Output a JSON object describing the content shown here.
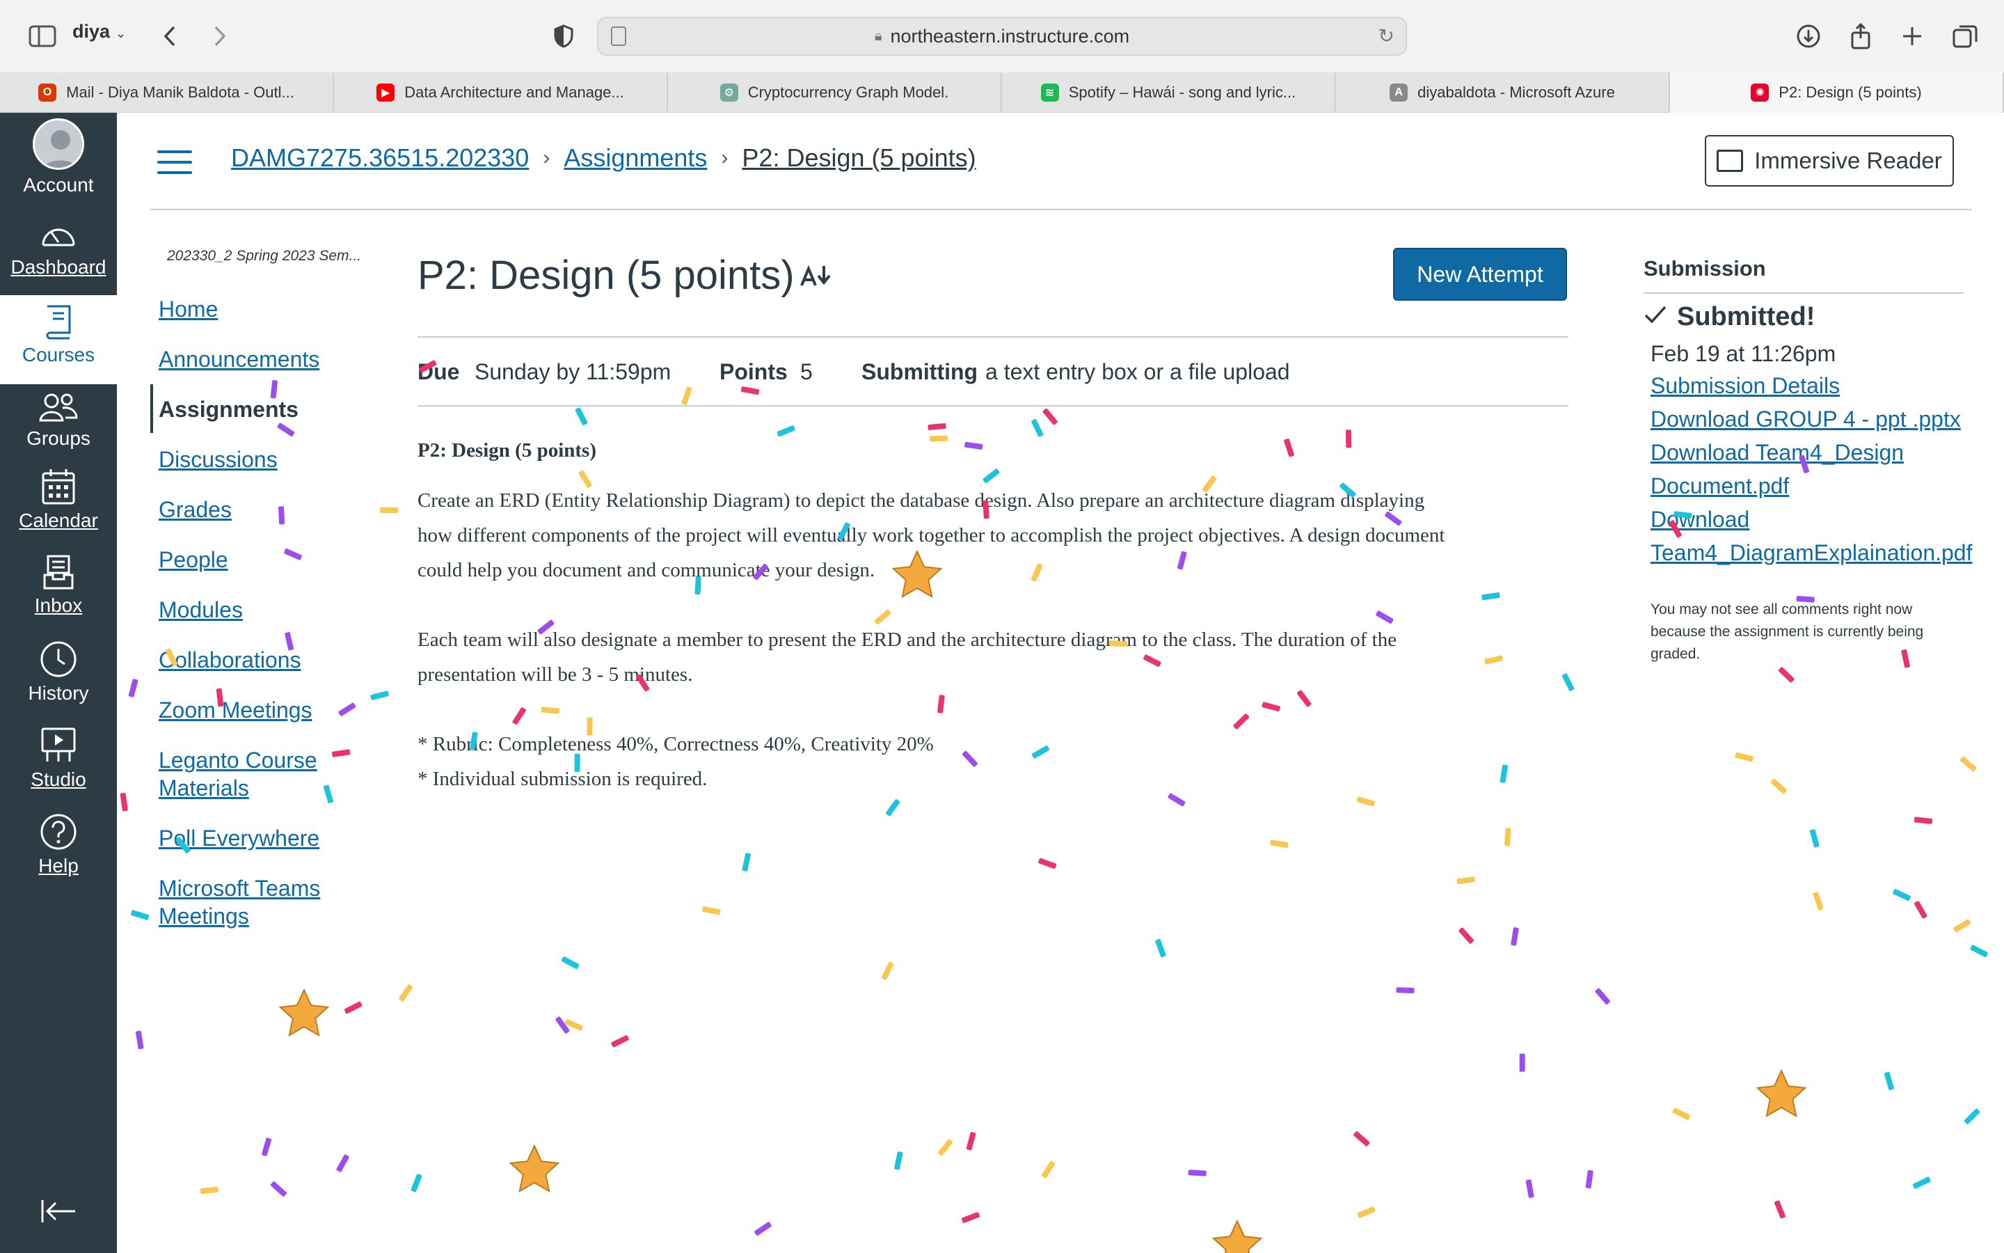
{
  "browser": {
    "profile": "diya",
    "url": "northeastern.instructure.com",
    "tabs": [
      {
        "label": "Mail - Diya Manik Baldota - Outl...",
        "color": "#d83b01",
        "glyph": "O"
      },
      {
        "label": "Data Architecture and Manage...",
        "color": "#ff0000",
        "glyph": "▶"
      },
      {
        "label": "Cryptocurrency Graph Model.",
        "color": "#74aa9c",
        "glyph": "⚙"
      },
      {
        "label": "Spotify – Hawái - song and lyric...",
        "color": "#1db954",
        "glyph": "≋"
      },
      {
        "label": "diyabaldota - Microsoft Azure",
        "color": "#8a8a8a",
        "glyph": "A"
      },
      {
        "label": "P2: Design (5 points)",
        "color": "#e4002b",
        "glyph": "✺"
      }
    ]
  },
  "global_nav": {
    "account": "Account",
    "dashboard": "Dashboard",
    "courses": "Courses",
    "groups": "Groups",
    "calendar": "Calendar",
    "inbox": "Inbox",
    "history": "History",
    "studio": "Studio",
    "help": "Help"
  },
  "header": {
    "breadcrumb": [
      "DAMG7275.36515.202330",
      "Assignments",
      "P2: Design (5 points)"
    ],
    "immersive_reader": "Immersive Reader"
  },
  "course_nav": {
    "term": "202330_2 Spring 2023 Sem...",
    "items": [
      "Home",
      "Announcements",
      "Assignments",
      "Discussions",
      "Grades",
      "People",
      "Modules",
      "Collaborations",
      "Zoom Meetings",
      "Leganto Course Materials",
      "Poll Everywhere",
      "Microsoft Teams Meetings"
    ]
  },
  "assignment": {
    "title": "P2: Design (5 points)",
    "new_attempt": "New Attempt",
    "due_label": "Due",
    "due_value": "Sunday by 11:59pm",
    "points_label": "Points",
    "points_value": "5",
    "submitting_label": "Submitting",
    "submitting_value": "a text entry box or a file upload",
    "heading": "P2: Design (5 points)",
    "para1_l1": "Create an ERD (Entity Relationship Diagram) to depict the database design. Also prepare an architecture diagram displaying",
    "para1_l2": "how different components of the project will eventually work together to accomplish the project objectives. A design document",
    "para1_l3": "could help you document and communicate your design.",
    "para2_l1": "Each team will also designate a member to present the ERD and the architecture diagram to the class. The duration of the",
    "para2_l2": "presentation will be 3 - 5 minutes.",
    "bullet1": "* Rubric: Completeness 40%, Correctness 40%, Creativity 20%",
    "bullet2": "* Individual submission is required."
  },
  "submission": {
    "heading": "Submission",
    "status": "Submitted!",
    "date": "Feb 19 at 11:26pm",
    "details": "Submission Details",
    "dl1": "Download GROUP 4 - ppt .pptx",
    "dl2a": "Download Team4_Design",
    "dl2b": "Document.pdf",
    "dl3a": "Download",
    "dl3b": "Team4_DiagramExplaination.pdf",
    "note": "You may not see all comments right now because the assignment is currently being graded."
  },
  "colors": {
    "nav_bg": "#2d3b45",
    "link": "#0f6aa3",
    "button": "#0f6aa3",
    "confetti": [
      "#e8336d",
      "#1cc3dd",
      "#9d4dee",
      "#f9c74f"
    ],
    "star": "#f4a93c"
  }
}
